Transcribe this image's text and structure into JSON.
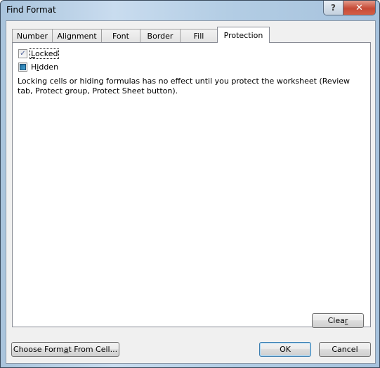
{
  "window": {
    "title": "Find Format",
    "help_button": "?",
    "close_button": "✕"
  },
  "tabs": [
    {
      "label": "Number",
      "active": false
    },
    {
      "label": "Alignment",
      "active": false
    },
    {
      "label": "Font",
      "active": false
    },
    {
      "label": "Border",
      "active": false
    },
    {
      "label": "Fill",
      "active": false
    },
    {
      "label": "Protection",
      "active": true
    }
  ],
  "protection": {
    "locked": {
      "label_pre": "",
      "label_accel": "L",
      "label_post": "ocked",
      "state": "checked"
    },
    "hidden": {
      "label_pre": "H",
      "label_accel": "i",
      "label_post": "dden",
      "state": "indeterminate"
    },
    "note": "Locking cells or hiding formulas has no effect until you protect the worksheet (Review tab, Protect group, Protect Sheet button)."
  },
  "buttons": {
    "clear": {
      "pre": "Clea",
      "accel": "r",
      "post": ""
    },
    "choose_format": {
      "pre": "Choose Form",
      "accel": "a",
      "post": "t From Cell..."
    },
    "ok": "OK",
    "cancel": "Cancel"
  }
}
